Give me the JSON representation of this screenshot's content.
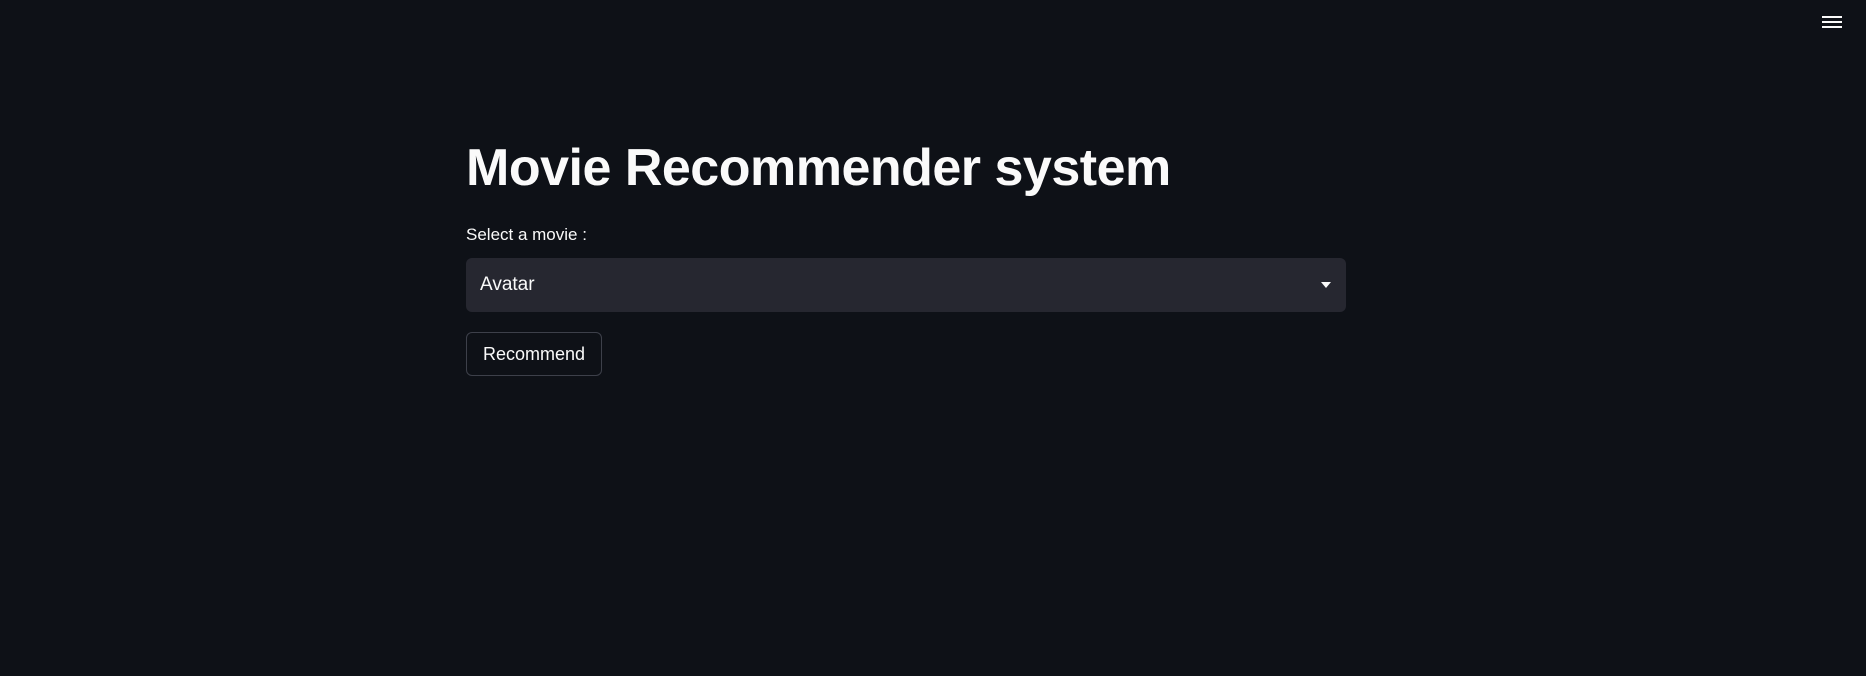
{
  "header": {
    "menu_icon": "hamburger-menu-icon"
  },
  "main": {
    "title": "Movie Recommender system",
    "select": {
      "label": "Select a movie :",
      "value": "Avatar",
      "icon": "chevron-down-icon"
    },
    "recommend_label": "Recommend"
  },
  "colors": {
    "background": "#0e1117",
    "select_background": "#262730",
    "text": "#fafafa",
    "button_border": "#3d404a"
  }
}
